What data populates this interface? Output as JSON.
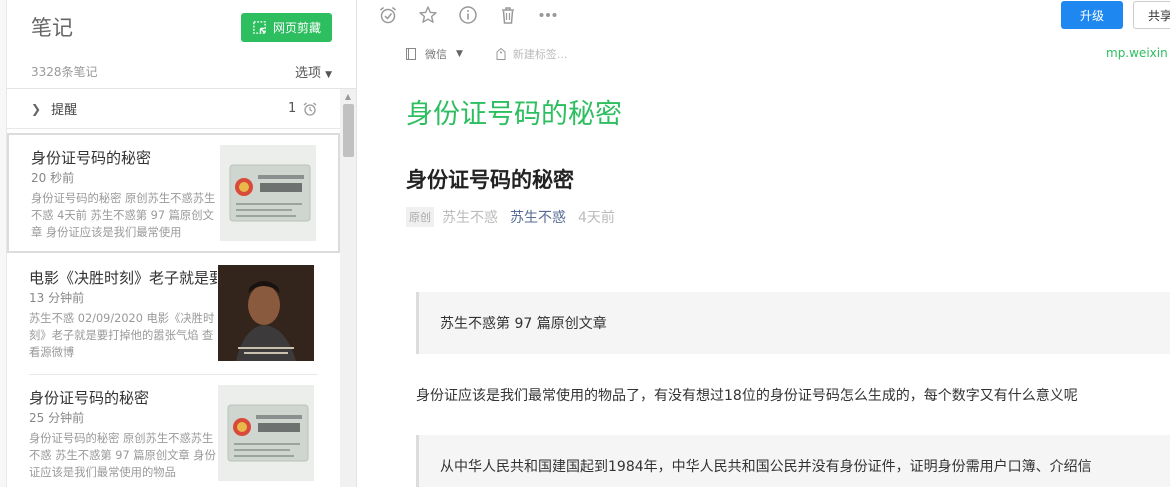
{
  "sidebar": {
    "title": "笔记",
    "clip_button": "网页剪藏",
    "note_count": "3328条笔记",
    "options": "选项",
    "reminder": {
      "label": "提醒",
      "count": "1"
    },
    "notes": [
      {
        "title": "身份证号码的秘密",
        "time": "20 秒前",
        "snippet": "身份证号码的秘密 原创苏生不惑苏生不惑 4天前 苏生不惑第 97 篇原创文章 身份证应该是我们最常使用",
        "thumb": "id-card"
      },
      {
        "title": "电影《决胜时刻》老子就是要打掉他的嚣张气焰",
        "time": "13 分钟前",
        "snippet": "苏生不惑 02/09/2020 电影《决胜时刻》老子就是要打掉他的嚣张气焰  查看源微博",
        "thumb": "movie"
      },
      {
        "title": "身份证号码的秘密",
        "time": "25 分钟前",
        "snippet": "身份证号码的秘密 原创苏生不惑苏生不惑 苏生不惑第 97 篇原创文章 身份证应该是我们最常使用的物品",
        "thumb": "id-card"
      }
    ]
  },
  "toolbar": {
    "upgrade": "升级",
    "share": "共享",
    "icons": [
      "alarm-icon",
      "star-icon",
      "info-icon",
      "trash-icon",
      "more-icon"
    ]
  },
  "editor": {
    "notebook": "微信",
    "tag_placeholder": "新建标签...",
    "source_url": "mp.weixin",
    "note_title": "身份证号码的秘密",
    "article_title": "身份证号码的秘密",
    "badge": "原创",
    "author1": "苏生不惑",
    "author2": "苏生不惑",
    "date": "4天前",
    "quote1": "苏生不惑第 97 篇原创文章",
    "para1": "身份证应该是我们最常使用的物品了，有没有想过18位的身份证号码怎么生成的，每个数字又有什么意义呢",
    "quote2": "从中华人民共和国建国起到1984年，中华人民共和国公民并没有身份证件，证明身份需用户口簿、介绍信"
  },
  "colors": {
    "accent_green": "#2dbe60",
    "upgrade_blue": "#1e88f0",
    "link_blue": "#576b95"
  }
}
